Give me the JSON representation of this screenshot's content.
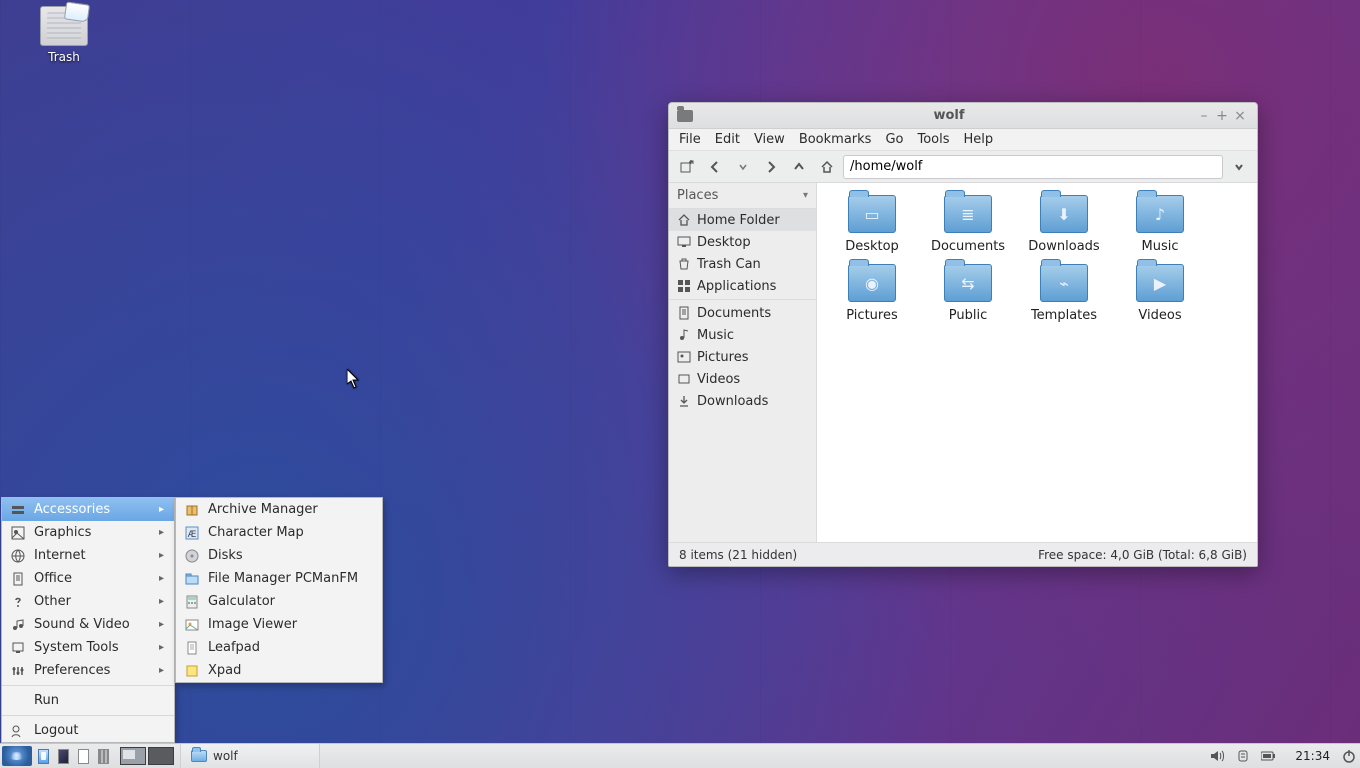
{
  "desktop": {
    "trash_label": "Trash"
  },
  "taskbar": {
    "task_label": "wolf",
    "clock": "21:34"
  },
  "app_menu": {
    "categories": [
      {
        "label": "Accessories",
        "icon": "accessories"
      },
      {
        "label": "Graphics",
        "icon": "graphics"
      },
      {
        "label": "Internet",
        "icon": "internet"
      },
      {
        "label": "Office",
        "icon": "office"
      },
      {
        "label": "Other",
        "icon": "other"
      },
      {
        "label": "Sound & Video",
        "icon": "multimedia"
      },
      {
        "label": "System Tools",
        "icon": "systemtools"
      },
      {
        "label": "Preferences",
        "icon": "preferences"
      }
    ],
    "run_label": "Run",
    "logout_label": "Logout",
    "submenu": [
      {
        "label": "Archive Manager",
        "icon": "archive"
      },
      {
        "label": "Character Map",
        "icon": "charmap"
      },
      {
        "label": "Disks",
        "icon": "disks"
      },
      {
        "label": "File Manager PCManFM",
        "icon": "filemanager"
      },
      {
        "label": "Galculator",
        "icon": "calc"
      },
      {
        "label": "Image Viewer",
        "icon": "image"
      },
      {
        "label": "Leafpad",
        "icon": "text"
      },
      {
        "label": "Xpad",
        "icon": "xpad"
      }
    ]
  },
  "filemanager": {
    "title": "wolf",
    "menubar": [
      "File",
      "Edit",
      "View",
      "Bookmarks",
      "Go",
      "Tools",
      "Help"
    ],
    "path": "/home/wolf",
    "sidebar_header": "Places",
    "places": [
      {
        "label": "Home Folder",
        "icon": "home",
        "selected": true
      },
      {
        "label": "Desktop",
        "icon": "desktop"
      },
      {
        "label": "Trash Can",
        "icon": "trash"
      },
      {
        "label": "Applications",
        "icon": "apps"
      }
    ],
    "places2": [
      {
        "label": "Documents",
        "icon": "doc"
      },
      {
        "label": "Music",
        "icon": "music"
      },
      {
        "label": "Pictures",
        "icon": "pictures"
      },
      {
        "label": "Videos",
        "icon": "videos"
      },
      {
        "label": "Downloads",
        "icon": "downloads"
      }
    ],
    "icons": [
      {
        "label": "Desktop",
        "glyph": "▭"
      },
      {
        "label": "Documents",
        "glyph": "≣"
      },
      {
        "label": "Downloads",
        "glyph": "⬇"
      },
      {
        "label": "Music",
        "glyph": "♪"
      },
      {
        "label": "Pictures",
        "glyph": "◉"
      },
      {
        "label": "Public",
        "glyph": "⇆"
      },
      {
        "label": "Templates",
        "glyph": "⌁"
      },
      {
        "label": "Videos",
        "glyph": "▶"
      }
    ],
    "status_left": "8 items (21 hidden)",
    "status_right": "Free space: 4,0 GiB (Total: 6,8 GiB)"
  }
}
